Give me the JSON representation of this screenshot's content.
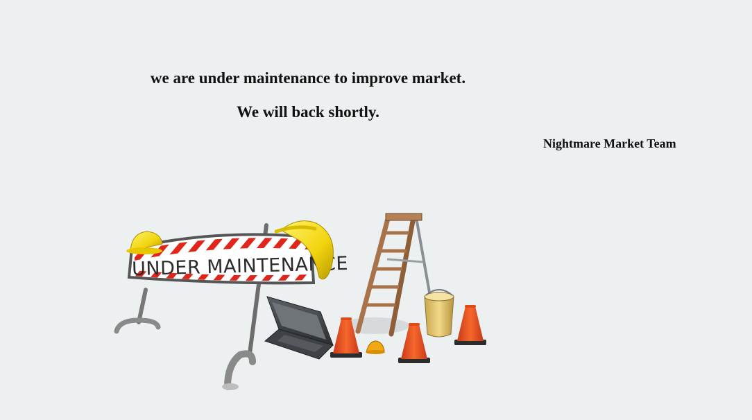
{
  "message": {
    "line1": "we are under maintenance to improve market.",
    "line2": "We will back shortly."
  },
  "signature": "Nightmare Market Team",
  "illustration": {
    "sign_text": "UNDER MAINTENANCE",
    "colors": {
      "background": "#ecf0f1",
      "stripe_red": "#e0251b",
      "hard_hat": "#f2d40f",
      "cone": "#f0541e",
      "ladder": "#a8734a",
      "bucket": "#e3c46a"
    }
  }
}
